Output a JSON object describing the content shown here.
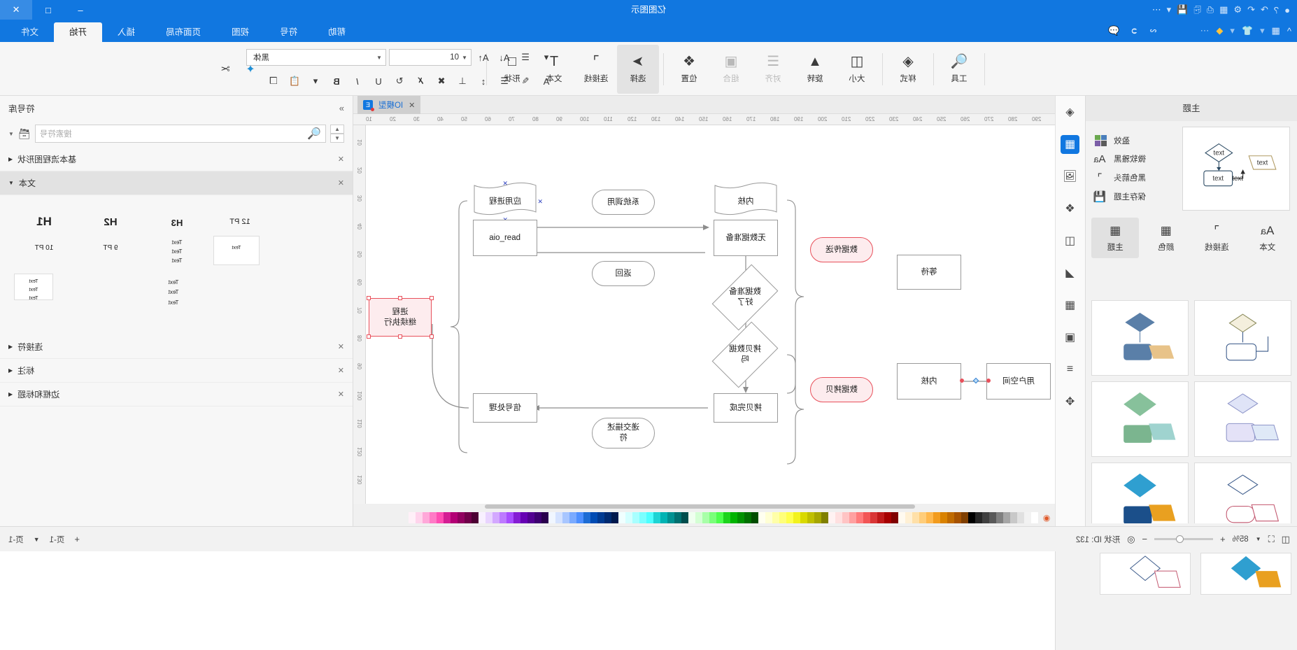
{
  "window": {
    "title": "亿图图示",
    "buttons": {
      "minimize": "–",
      "maximize": "□",
      "close": "✕"
    },
    "quick_access": [
      "undo-icon",
      "redo-icon",
      "save-icon",
      "new-icon",
      "print-icon",
      "export-icon",
      "account-icon"
    ]
  },
  "ribbon": {
    "tabs": [
      {
        "label": "文件",
        "active": false
      },
      {
        "label": "开始",
        "active": true
      },
      {
        "label": "插入",
        "active": false
      },
      {
        "label": "页面布局",
        "active": false
      },
      {
        "label": "视图",
        "active": false
      },
      {
        "label": "符号",
        "active": false
      },
      {
        "label": "帮助",
        "active": false
      }
    ],
    "left_tools": [
      "collapse-icon",
      "grid-icon",
      "theme-icon",
      "premium-icon",
      "more-icon"
    ],
    "mid_tools": [
      "share-icon",
      "pointer-icon",
      "comment-icon"
    ],
    "groups": [
      {
        "label": "工具",
        "icon": "tool-icon",
        "disabled": false,
        "selected": false
      },
      {
        "label": "样式",
        "icon": "fill-icon",
        "disabled": false,
        "selected": false
      },
      {
        "label": "大小",
        "icon": "size-icon",
        "disabled": false,
        "selected": false
      },
      {
        "label": "旋转",
        "icon": "rotate-icon",
        "disabled": false,
        "selected": false
      },
      {
        "label": "对齐",
        "icon": "align-icon",
        "disabled": true,
        "selected": false
      },
      {
        "label": "组合",
        "icon": "group-icon",
        "disabled": true,
        "selected": false
      },
      {
        "label": "位置",
        "icon": "layers-icon",
        "disabled": false,
        "selected": false
      },
      {
        "label": "选择",
        "icon": "cursor-icon",
        "disabled": false,
        "selected": true
      },
      {
        "label": "连接线",
        "icon": "connector-icon",
        "disabled": false,
        "selected": false
      },
      {
        "label": "文本",
        "icon": "text-icon",
        "disabled": false,
        "selected": false
      },
      {
        "label": "形状",
        "icon": "shape-icon",
        "disabled": false,
        "selected": false
      }
    ],
    "font": {
      "family_value": "黑体",
      "size_value": "10",
      "row1_icons": [
        "align-menu-icon",
        "font-shrink-icon",
        "font-grow-icon"
      ],
      "row2_icons": [
        "font-color-icon",
        "highlight-icon",
        "list-icon",
        "line-spacing-icon",
        "valign-icon",
        "strikethrough-icon",
        "clear-format-icon",
        "rotate-text-icon",
        "underline-icon",
        "italic-icon",
        "bold-icon"
      ],
      "right_icons": [
        "paste-icon",
        "copy-icon",
        "format-painter-icon",
        "cut-icon"
      ]
    }
  },
  "left_panel": {
    "title": "主题",
    "theme_options": [
      {
        "label": "盈效",
        "icon": "swatch-icon"
      },
      {
        "label": "微软雅黑",
        "icon": "font-aa-icon"
      },
      {
        "label": "黑色箭头",
        "icon": "connector-icon"
      },
      {
        "label": "保存主题",
        "icon": "save-icon"
      }
    ],
    "tabs": [
      {
        "label": "主题",
        "icon": "theme-icon",
        "active": true
      },
      {
        "label": "颜色",
        "icon": "color-icon",
        "active": false
      },
      {
        "label": "连接线",
        "icon": "connector-icon",
        "active": false
      },
      {
        "label": "文本",
        "icon": "text-aa-icon",
        "active": false
      }
    ],
    "preview_labels": [
      "text",
      "text",
      "text",
      "text"
    ],
    "thumbnails": [
      {
        "c1": "#e8c389",
        "c2": "#5a7fa8"
      },
      {
        "c1": "#f4efdd",
        "c2": "#ffffff"
      },
      {
        "c1": "#9fd3cf",
        "c2": "#87c19b"
      },
      {
        "c1": "#cfd8f5",
        "c2": "#b9b6e8"
      },
      {
        "c1": "#e9a020",
        "c2": "#1b4f8a"
      },
      {
        "c1": "#f3d2da",
        "c2": "#ffffff"
      }
    ]
  },
  "rail": {
    "items": [
      "fill-icon",
      "shapes-icon",
      "image-icon",
      "layers-icon",
      "container-icon",
      "chart-icon",
      "table-icon",
      "frame-icon",
      "flow-icon",
      "shuffle-icon"
    ]
  },
  "document": {
    "tab_label": "IO模型",
    "tab_close": "✕",
    "ruler_h_ticks": [
      "10",
      "20",
      "30",
      "40",
      "50",
      "60",
      "70",
      "80",
      "90",
      "100",
      "110",
      "120",
      "130",
      "140",
      "150",
      "160",
      "170",
      "180",
      "190",
      "200",
      "210",
      "220",
      "230",
      "240",
      "250",
      "260",
      "270",
      "280",
      "290"
    ],
    "ruler_v_ticks": [
      "10",
      "20",
      "30",
      "40",
      "50",
      "60",
      "70",
      "80",
      "90",
      "100",
      "110",
      "120",
      "130"
    ]
  },
  "diagram": {
    "nodes": [
      {
        "id": "kernel-top",
        "type": "document",
        "label": "内核"
      },
      {
        "id": "no-data",
        "type": "process",
        "label": "无数据准备"
      },
      {
        "id": "data-ready",
        "type": "decision",
        "label": "数据准备\n好了"
      },
      {
        "id": "copy-data",
        "type": "decision",
        "label": "拷贝数据\n吗"
      },
      {
        "id": "copy-done",
        "type": "process",
        "label": "拷贝完成"
      },
      {
        "id": "app-proc",
        "type": "document",
        "label": "应用进程"
      },
      {
        "id": "aio-read",
        "type": "process",
        "label": "aio_read"
      },
      {
        "id": "signal",
        "type": "process",
        "label": "信号处理"
      },
      {
        "id": "syscall",
        "type": "round",
        "label": "系统调用"
      },
      {
        "id": "ret",
        "type": "round",
        "label": "返回"
      },
      {
        "id": "deliver",
        "type": "round",
        "label": "递交描述\n符"
      },
      {
        "id": "wait",
        "type": "process",
        "label": "等待"
      },
      {
        "id": "kernel-2",
        "type": "process",
        "label": "内核"
      },
      {
        "id": "user-space",
        "type": "process",
        "label": "用户空间"
      },
      {
        "id": "send-data",
        "type": "pill-red",
        "label": "数据传送"
      },
      {
        "id": "copy-label",
        "type": "pill-red",
        "label": "数据拷贝"
      },
      {
        "id": "proc-continue",
        "type": "selected",
        "label": "进程\n继续执行"
      }
    ]
  },
  "palette": {
    "colors": [
      "#ffffff",
      "#f2f2f2",
      "#e0e0e0",
      "#c8c8c8",
      "#a6a6a6",
      "#808080",
      "#595959",
      "#404040",
      "#262626",
      "#000000",
      "#7f3f00",
      "#a65200",
      "#bf6a00",
      "#d98200",
      "#f29b1d",
      "#ffb84d",
      "#ffcd7a",
      "#ffe0a8",
      "#fff0d4",
      "#fffaf0",
      "#7f0000",
      "#a60000",
      "#bf1a1a",
      "#d93636",
      "#f25555",
      "#ff7a7a",
      "#ffa0a0",
      "#ffc4c4",
      "#ffe0e0",
      "#fff2f2",
      "#7f7f00",
      "#a6a600",
      "#bfbf00",
      "#d9d900",
      "#f2f21d",
      "#ffff4d",
      "#ffff7a",
      "#ffffa8",
      "#ffffd4",
      "#fffff0",
      "#004d00",
      "#007000",
      "#009100",
      "#00b300",
      "#1dd41d",
      "#4dff4d",
      "#7aff7a",
      "#a8ffa8",
      "#d4ffd4",
      "#f0fff0",
      "#004d4d",
      "#007070",
      "#009191",
      "#00b3b3",
      "#1dd4d4",
      "#4dffff",
      "#7affff",
      "#a8ffff",
      "#d4ffff",
      "#f0ffff",
      "#00194d",
      "#002a70",
      "#003a91",
      "#004bb3",
      "#1d6cd4",
      "#4d8fff",
      "#7aaaff",
      "#a8c6ff",
      "#d4e2ff",
      "#f0f6ff",
      "#2a004d",
      "#3d0070",
      "#520091",
      "#6600b3",
      "#851dd4",
      "#a84dff",
      "#bd7aff",
      "#d3a8ff",
      "#e9d4ff",
      "#f8f0ff",
      "#4d0033",
      "#700049",
      "#91005f",
      "#b30075",
      "#d41d93",
      "#ff4db3",
      "#ff7ac6",
      "#ffa8d9",
      "#ffd4ec",
      "#fff0f8"
    ],
    "more_icon": "eyedropper-icon"
  },
  "right_panel": {
    "title": "符号库",
    "collapse_icon": "chevron-right-icon",
    "search_placeholder": "搜索符号",
    "search_icon": "search-icon",
    "library_icon": "library-icon",
    "groups": [
      {
        "label": "基本流程图形状",
        "open": false,
        "close_icon": "✕"
      },
      {
        "label": "文本",
        "open": true,
        "close_icon": "✕"
      },
      {
        "label": "连接符",
        "open": false,
        "close_icon": "✕"
      },
      {
        "label": "标注",
        "open": false,
        "close_icon": "✕"
      },
      {
        "label": "边框和标题",
        "open": false,
        "close_icon": "✕"
      }
    ],
    "text_stencils": [
      {
        "label": "H1",
        "sub": "10 PT"
      },
      {
        "label": "H2",
        "sub": "9 PT"
      },
      {
        "label": "H3",
        "sub": "Text\nText\nText"
      },
      {
        "label": "12 PT",
        "sub": "Text"
      },
      {
        "label": "bullets",
        "sub": "Text\nText\nText"
      },
      {
        "label": "block",
        "sub": "Text\nText\nText"
      }
    ]
  },
  "status_bar": {
    "shape_id_label": "形状 ID: 132",
    "zoom_value": "85%",
    "zoom_out": "−",
    "zoom_in": "+",
    "fit_icon": "fit-icon",
    "fullscreen_icon": "fullscreen-icon",
    "target_icon": "target-icon",
    "page_label": "页-1",
    "page_tab_label": "页-1",
    "add_page": "+",
    "page_menu_icon": "chevron-down-icon"
  }
}
